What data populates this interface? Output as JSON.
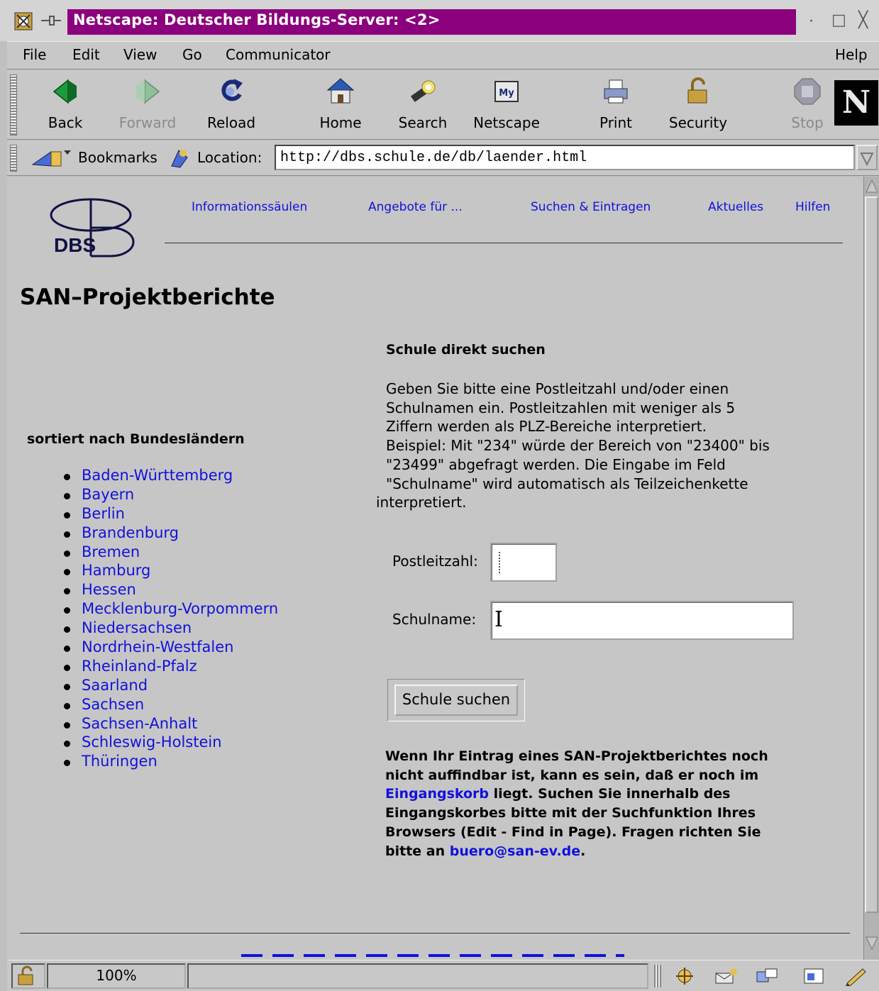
{
  "window": {
    "title": "Netscape: Deutscher Bildungs-Server: <2>"
  },
  "menubar": {
    "file": "File",
    "edit": "Edit",
    "view": "View",
    "go": "Go",
    "communicator": "Communicator",
    "help": "Help"
  },
  "toolbar": {
    "back": "Back",
    "forward": "Forward",
    "reload": "Reload",
    "home": "Home",
    "search": "Search",
    "netscape": "Netscape",
    "print": "Print",
    "security": "Security",
    "stop": "Stop",
    "logo_letter": "N"
  },
  "location_bar": {
    "bookmarks": "Bookmarks",
    "location_label": "Location:",
    "url": "http://dbs.schule.de/db/laender.html"
  },
  "page": {
    "logo_text": "DBS",
    "nav": [
      "Informationssäulen",
      "Angebote für ...",
      "Suchen & Eintragen",
      "Aktuelles",
      "Hilfen"
    ],
    "title": "SAN–Projektberichte",
    "sort_heading": "sortiert nach Bundesländern",
    "states": [
      "Baden-Württemberg",
      "Bayern",
      "Berlin",
      "Brandenburg",
      "Bremen",
      "Hamburg",
      "Hessen",
      "Mecklenburg-Vorpommern",
      "Niedersachsen",
      "Nordrhein-Westfalen",
      "Rheinland-Pfalz",
      "Saarland",
      "Sachsen",
      "Sachsen-Anhalt",
      "Schleswig-Holstein",
      "Thüringen"
    ],
    "search": {
      "heading": "Schule direkt suchen",
      "description_lines": [
        "Geben Sie bitte eine Postleitzahl und/oder einen",
        "Schulnamen ein. Postleitzahlen mit weniger als 5",
        "Ziffern werden als PLZ-Bereiche interpretiert.",
        "Beispiel: Mit \"234\" würde der Bereich von \"23400\" bis",
        "\"23499\" abgefragt werden. Die Eingabe im Feld",
        "\"Schulname\" wird automatisch als Teilzeichenkette",
        "interpretiert."
      ],
      "plz_label": "Postleitzahl:",
      "plz_value": "",
      "name_label": "Schulname:",
      "name_value": "",
      "button": "Schule suchen"
    },
    "notice": {
      "line1": "Wenn Ihr Eintrag eines SAN-Projektberichtes noch",
      "line2": "nicht auffindbar ist, kann es sein, daß er noch im",
      "link_eingangskorb": "Eingangskorb",
      "line3_rest": " liegt. Suchen Sie innerhalb des",
      "line4": "Eingangskorbes bitte mit der Suchfunktion Ihres",
      "line5": "Browsers (Edit - Find in Page). Fragen richten Sie",
      "line6_start": "bitte an ",
      "link_email": "buero@san-ev.de",
      "line6_end": "."
    }
  },
  "statusbar": {
    "zoom": "100%"
  },
  "colors": {
    "title_bar": "#8b007c",
    "link": "#1111dd",
    "chrome": "#c8c8c8",
    "page_bg": "#c6c6c6"
  }
}
